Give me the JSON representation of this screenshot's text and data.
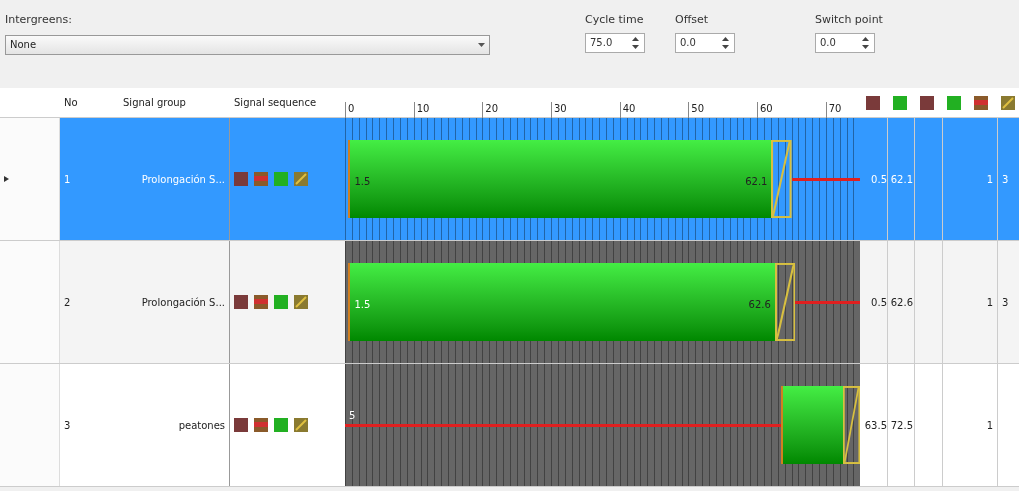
{
  "intergreens": {
    "label": "Intergreens:",
    "value": "None"
  },
  "spinners": [
    {
      "label": "Cycle time",
      "value": "75.0"
    },
    {
      "label": "Offset",
      "value": "0.0"
    },
    {
      "label": "Switch point",
      "value": "0.0"
    }
  ],
  "table": {
    "columns": [
      "No",
      "Signal group",
      "Signal sequence"
    ],
    "ticks": [
      "0",
      "10",
      "20",
      "30",
      "40",
      "50",
      "60",
      "70"
    ],
    "header_icons": [
      {
        "kind": "red"
      },
      {
        "kind": "green"
      },
      {
        "kind": "red"
      },
      {
        "kind": "green"
      },
      {
        "kind": "redamber"
      },
      {
        "kind": "amber"
      }
    ],
    "rows": [
      {
        "selected": true,
        "no": "1",
        "name": "Prolongación S...",
        "sequence": [
          {
            "kind": "red"
          },
          {
            "kind": "redamber"
          },
          {
            "kind": "green"
          },
          {
            "kind": "amber"
          }
        ],
        "start_label": "1.5",
        "end_label": "62.1",
        "green_start": "0.5",
        "green_end": "62.1",
        "column_9": "1",
        "column_10": "3"
      },
      {
        "selected": false,
        "no": "2",
        "name": "Prolongación S...",
        "sequence": [
          {
            "kind": "red"
          },
          {
            "kind": "redamber"
          },
          {
            "kind": "green"
          },
          {
            "kind": "amber"
          }
        ],
        "start_label": "1.5",
        "end_label": "62.6",
        "green_start": "0.5",
        "green_end": "62.6",
        "column_9": "1",
        "column_10": "3"
      },
      {
        "selected": false,
        "no": "3",
        "name": "peatones",
        "sequence": [
          {
            "kind": "red"
          },
          {
            "kind": "redamber"
          },
          {
            "kind": "green"
          },
          {
            "kind": "amber"
          }
        ],
        "start_label": "5",
        "green_start": "63.5",
        "green_end": "72.5",
        "column_9": "1"
      }
    ]
  }
}
